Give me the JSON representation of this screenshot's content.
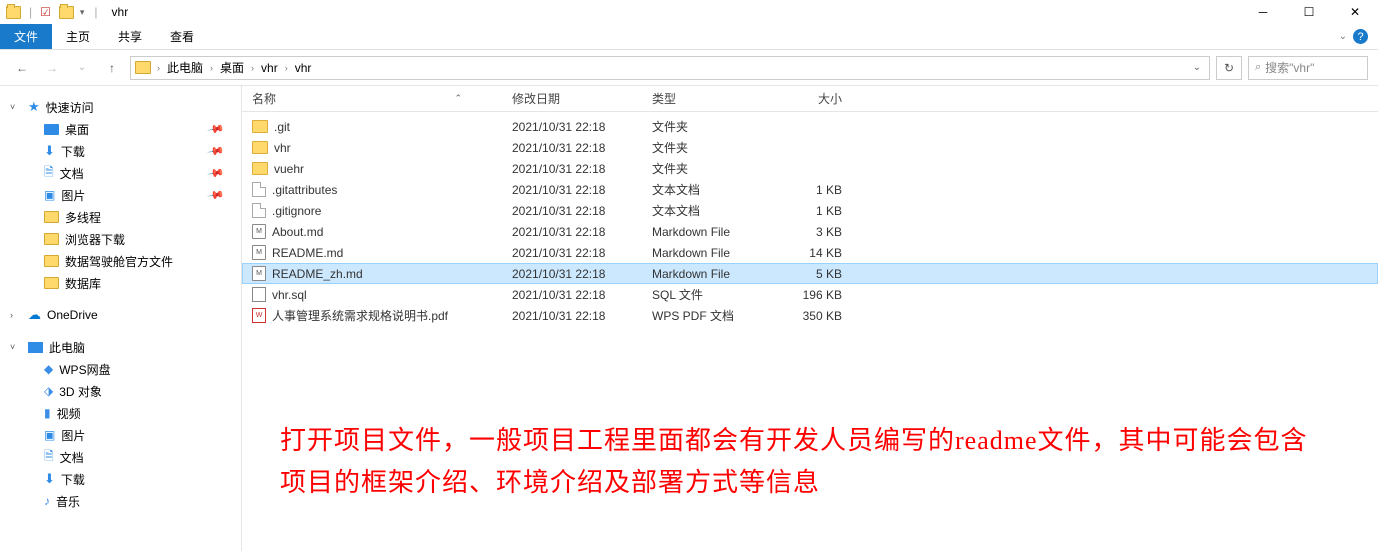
{
  "window": {
    "title": "vhr"
  },
  "ribbon": {
    "tabs": {
      "file": "文件",
      "home": "主页",
      "share": "共享",
      "view": "查看"
    }
  },
  "breadcrumb": {
    "items": [
      "此电脑",
      "桌面",
      "vhr",
      "vhr"
    ]
  },
  "search": {
    "placeholder": "搜索\"vhr\""
  },
  "sidebar": {
    "quick_access": "快速访问",
    "desktop": "桌面",
    "downloads": "下载",
    "documents": "文档",
    "pictures": "图片",
    "multithread": "多线程",
    "browser_dl": "浏览器下载",
    "data_cockpit": "数据驾驶舱官方文件",
    "database": "数据库",
    "onedrive": "OneDrive",
    "this_pc": "此电脑",
    "wps": "WPS网盘",
    "obj3d": "3D 对象",
    "video": "视频",
    "pictures2": "图片",
    "documents2": "文档",
    "downloads2": "下载",
    "music": "音乐"
  },
  "columns": {
    "name": "名称",
    "date": "修改日期",
    "type": "类型",
    "size": "大小"
  },
  "files": [
    {
      "icon": "folder",
      "name": ".git",
      "date": "2021/10/31 22:18",
      "type": "文件夹",
      "size": ""
    },
    {
      "icon": "folder",
      "name": "vhr",
      "date": "2021/10/31 22:18",
      "type": "文件夹",
      "size": ""
    },
    {
      "icon": "folder",
      "name": "vuehr",
      "date": "2021/10/31 22:18",
      "type": "文件夹",
      "size": ""
    },
    {
      "icon": "file",
      "name": ".gitattributes",
      "date": "2021/10/31 22:18",
      "type": "文本文档",
      "size": "1 KB"
    },
    {
      "icon": "file",
      "name": ".gitignore",
      "date": "2021/10/31 22:18",
      "type": "文本文档",
      "size": "1 KB"
    },
    {
      "icon": "md",
      "name": "About.md",
      "date": "2021/10/31 22:18",
      "type": "Markdown File",
      "size": "3 KB"
    },
    {
      "icon": "md",
      "name": "README.md",
      "date": "2021/10/31 22:18",
      "type": "Markdown File",
      "size": "14 KB"
    },
    {
      "icon": "md",
      "name": "README_zh.md",
      "date": "2021/10/31 22:18",
      "type": "Markdown File",
      "size": "5 KB",
      "selected": true
    },
    {
      "icon": "sql",
      "name": "vhr.sql",
      "date": "2021/10/31 22:18",
      "type": "SQL 文件",
      "size": "196 KB"
    },
    {
      "icon": "pdf",
      "name": "人事管理系统需求规格说明书.pdf",
      "date": "2021/10/31 22:18",
      "type": "WPS PDF 文档",
      "size": "350 KB"
    }
  ],
  "annotation": "打开项目文件，一般项目工程里面都会有开发人员编写的readme文件，其中可能会包含项目的框架介绍、环境介绍及部署方式等信息"
}
